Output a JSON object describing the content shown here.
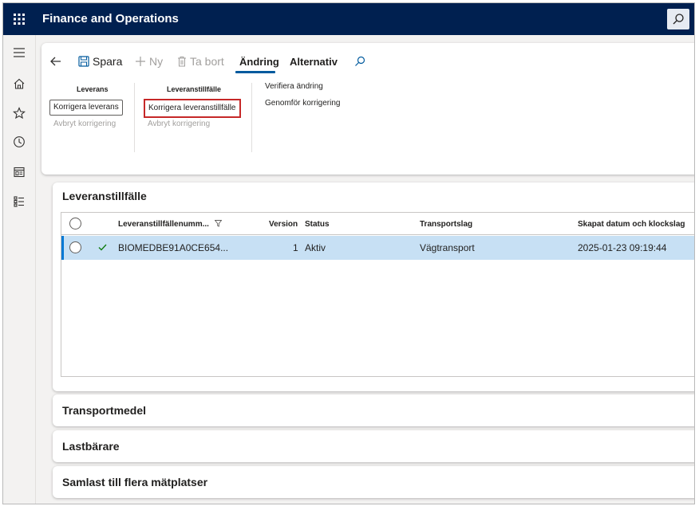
{
  "header": {
    "app_title": "Finance and Operations"
  },
  "nav": {
    "icons": [
      "menu-icon",
      "home-icon",
      "favorites-star-icon",
      "recent-clock-icon",
      "workspaces-icon",
      "modules-list-icon"
    ]
  },
  "toolbar": {
    "save_label": "Spara",
    "new_label": "Ny",
    "delete_label": "Ta bort",
    "tab_change": "Ändring",
    "tab_alternative": "Alternativ"
  },
  "groups": {
    "leverans": {
      "title": "Leverans",
      "correct_label": "Korrigera leverans",
      "cancel_label": "Avbryt korrigering"
    },
    "leveranstillfalle": {
      "title": "Leveranstillfälle",
      "correct_label": "Korrigera leveranstillfälle",
      "cancel_label": "Avbryt korrigering"
    },
    "other": {
      "verify_label": "Verifiera ändring",
      "execute_label": "Genomför korrigering"
    }
  },
  "grid_section": {
    "title": "Leveranstillfälle",
    "columns": {
      "number": "Leveranstillfällenumm...",
      "version": "Version",
      "status": "Status",
      "transport": "Transportslag",
      "created": "Skapat datum och klockslag"
    },
    "rows": [
      {
        "number": "BIOMEDBE91A0CE654...",
        "version": "1",
        "status": "Aktiv",
        "transport": "Vägtransport",
        "created": "2025-01-23 09:19:44"
      }
    ]
  },
  "sections": {
    "transport": "Transportmedel",
    "carrier": "Lastbärare",
    "consolidated": "Samlast till flera mätplatser"
  },
  "colors": {
    "topbar": "#002050",
    "accent": "#0078d4",
    "selected_row": "#c7e0f4",
    "highlight_border": "#c62828"
  }
}
